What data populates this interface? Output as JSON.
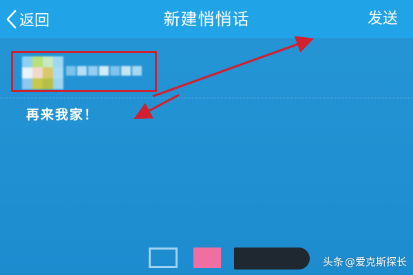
{
  "header": {
    "back_label": "返回",
    "title": "新建悄悄话",
    "send_label": "发送"
  },
  "recipient": {
    "avatar_colors": [
      "#8fd0f0",
      "#b7e07a",
      "#c6e9c0",
      "#9fd6f2",
      "#e8f4f8",
      "#f2d9d0",
      "#d9c96a",
      "#a9dcf4",
      "#8dc9ee",
      "#c8c84a",
      "#b8bf45",
      "#9dd4f0"
    ],
    "name_blur_colors": [
      "#7cc3ec",
      "#b5dff5",
      "#94cff0",
      "#d4ecf8",
      "#7fc4ec",
      "#c3e6f6",
      "#a8d8f2"
    ]
  },
  "message": {
    "text": "再来我家！"
  },
  "swatches": {
    "outline_color": "#9fd2f0",
    "pink_color": "#f06fa0",
    "dark_color": "#1f2730"
  },
  "watermark": {
    "text": "头条",
    "handle": "@爱克斯探长"
  },
  "colors": {
    "header_bg": "#21a3e8",
    "body_bg": "#1e8fd0",
    "annotation_red": "#d1202f"
  }
}
